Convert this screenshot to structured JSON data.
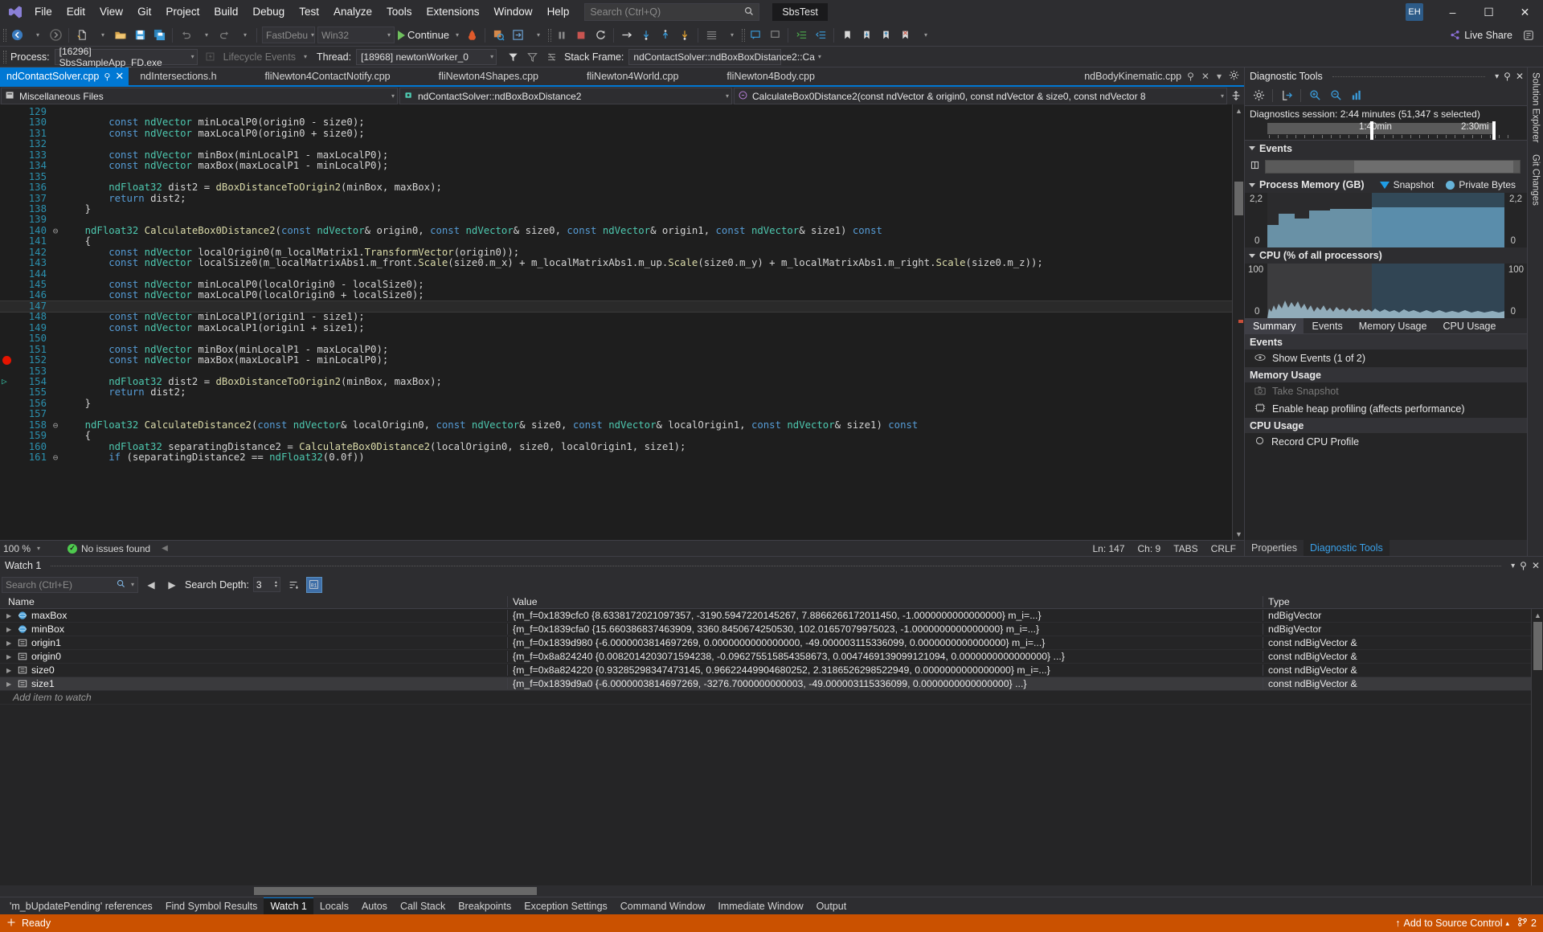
{
  "titlebar": {
    "menu": [
      "File",
      "Edit",
      "View",
      "Git",
      "Project",
      "Build",
      "Debug",
      "Test",
      "Analyze",
      "Tools",
      "Extensions",
      "Window",
      "Help"
    ],
    "search_placeholder": "Search (Ctrl+Q)",
    "solution_name": "SbsTest",
    "account_initials": "EH",
    "minimize": "–",
    "maximize": "☐",
    "close": "✕"
  },
  "toolbar": {
    "config": "FastDebu",
    "platform": "Win32",
    "continue_label": "Continue",
    "live_share": "Live Share"
  },
  "debugbar": {
    "process_label": "Process:",
    "process_value": "[16296] SbsSampleApp_FD.exe",
    "lifecycle_label": "Lifecycle Events",
    "thread_label": "Thread:",
    "thread_value": "[18968] newtonWorker_0",
    "stackframe_label": "Stack Frame:",
    "stackframe_value": "ndContactSolver::ndBoxBoxDistance2::Ca"
  },
  "tabs": [
    {
      "label": "ndContactSolver.cpp",
      "active": true
    },
    {
      "label": "ndIntersections.h",
      "active": false
    },
    {
      "label": "fliNewton4ContactNotify.cpp",
      "active": false
    },
    {
      "label": "fliNewton4Shapes.cpp",
      "active": false
    },
    {
      "label": "fliNewton4World.cpp",
      "active": false
    },
    {
      "label": "fliNewton4Body.cpp",
      "active": false
    },
    {
      "label": "ndBodyKinematic.cpp",
      "active": false
    }
  ],
  "navbar": {
    "project": "Miscellaneous Files",
    "type": "ndContactSolver::ndBoxBoxDistance2",
    "member": "CalculateBox0Distance2(const ndVector & origin0, const ndVector & size0, const ndVector 8"
  },
  "editor": {
    "first_line": 129,
    "highlight_line": 147,
    "breakpoint_line": 152,
    "bookmark_line": 154,
    "lines": [
      {
        "n": 129,
        "fold": "",
        "text": ""
      },
      {
        "n": 130,
        "fold": "",
        "text": "        const ndVector minLocalP0(origin0 - size0);"
      },
      {
        "n": 131,
        "fold": "",
        "text": "        const ndVector maxLocalP0(origin0 + size0);"
      },
      {
        "n": 132,
        "fold": "",
        "text": ""
      },
      {
        "n": 133,
        "fold": "",
        "text": "        const ndVector minBox(minLocalP1 - maxLocalP0);"
      },
      {
        "n": 134,
        "fold": "",
        "text": "        const ndVector maxBox(maxLocalP1 - minLocalP0);"
      },
      {
        "n": 135,
        "fold": "",
        "text": ""
      },
      {
        "n": 136,
        "fold": "",
        "text": "        ndFloat32 dist2 = dBoxDistanceToOrigin2(minBox, maxBox);"
      },
      {
        "n": 137,
        "fold": "",
        "text": "        return dist2;"
      },
      {
        "n": 138,
        "fold": "",
        "text": "    }"
      },
      {
        "n": 139,
        "fold": "",
        "text": ""
      },
      {
        "n": 140,
        "fold": "⊖",
        "text": "    ndFloat32 CalculateBox0Distance2(const ndVector& origin0, const ndVector& size0, const ndVector& origin1, const ndVector& size1) const"
      },
      {
        "n": 141,
        "fold": "",
        "text": "    {"
      },
      {
        "n": 142,
        "fold": "",
        "text": "        const ndVector localOrigin0(m_localMatrix1.TransformVector(origin0));"
      },
      {
        "n": 143,
        "fold": "",
        "text": "        const ndVector localSize0(m_localMatrixAbs1.m_front.Scale(size0.m_x) + m_localMatrixAbs1.m_up.Scale(size0.m_y) + m_localMatrixAbs1.m_right.Scale(size0.m_z));"
      },
      {
        "n": 144,
        "fold": "",
        "text": ""
      },
      {
        "n": 145,
        "fold": "",
        "text": "        const ndVector minLocalP0(localOrigin0 - localSize0);"
      },
      {
        "n": 146,
        "fold": "",
        "text": "        const ndVector maxLocalP0(localOrigin0 + localSize0);"
      },
      {
        "n": 147,
        "fold": "",
        "text": ""
      },
      {
        "n": 148,
        "fold": "",
        "text": "        const ndVector minLocalP1(origin1 - size1);"
      },
      {
        "n": 149,
        "fold": "",
        "text": "        const ndVector maxLocalP1(origin1 + size1);"
      },
      {
        "n": 150,
        "fold": "",
        "text": ""
      },
      {
        "n": 151,
        "fold": "",
        "text": "        const ndVector minBox(minLocalP1 - maxLocalP0);"
      },
      {
        "n": 152,
        "fold": "",
        "text": "        const ndVector maxBox(maxLocalP1 - minLocalP0);"
      },
      {
        "n": 153,
        "fold": "",
        "text": ""
      },
      {
        "n": 154,
        "fold": "",
        "text": "        ndFloat32 dist2 = dBoxDistanceToOrigin2(minBox, maxBox);"
      },
      {
        "n": 155,
        "fold": "",
        "text": "        return dist2;"
      },
      {
        "n": 156,
        "fold": "",
        "text": "    }"
      },
      {
        "n": 157,
        "fold": "",
        "text": ""
      },
      {
        "n": 158,
        "fold": "⊖",
        "text": "    ndFloat32 CalculateDistance2(const ndVector& localOrigin0, const ndVector& size0, const ndVector& localOrigin1, const ndVector& size1) const"
      },
      {
        "n": 159,
        "fold": "",
        "text": "    {"
      },
      {
        "n": 160,
        "fold": "",
        "text": "        ndFloat32 separatingDistance2 = CalculateBox0Distance2(localOrigin0, size0, localOrigin1, size1);"
      },
      {
        "n": 161,
        "fold": "⊖",
        "text": "        if (separatingDistance2 == ndFloat32(0.0f))"
      }
    ]
  },
  "editor_status": {
    "zoom": "100 %",
    "issues": "No issues found",
    "line": "Ln: 147",
    "col": "Ch: 9",
    "tabs": "TABS",
    "eol": "CRLF"
  },
  "diagnostics": {
    "title": "Diagnostic Tools",
    "session_text": "Diagnostics session: 2:44 minutes (51,347 s selected)",
    "ruler_labels": [
      "1:40min",
      "2:30mi"
    ],
    "events_section": "Events",
    "memory_section": "Process Memory (GB)",
    "memory_legend_snapshot": "Snapshot",
    "memory_legend_private": "Private Bytes",
    "memory_axis_top": "2,2",
    "memory_axis_bottom": "0",
    "cpu_section": "CPU (% of all processors)",
    "cpu_axis_top": "100",
    "cpu_axis_bottom": "0",
    "tabs": [
      "Summary",
      "Events",
      "Memory Usage",
      "CPU Usage"
    ],
    "active_tab": "Summary",
    "summary": [
      {
        "header": "Events",
        "items": [
          {
            "label": "Show Events (1 of 2)",
            "icon": "eye-icon",
            "disabled": false
          }
        ]
      },
      {
        "header": "Memory Usage",
        "items": [
          {
            "label": "Take Snapshot",
            "icon": "camera-icon",
            "disabled": true
          },
          {
            "label": "Enable heap profiling (affects performance)",
            "icon": "chip-icon",
            "disabled": false
          }
        ]
      },
      {
        "header": "CPU Usage",
        "items": [
          {
            "label": "Record CPU Profile",
            "icon": "record-icon",
            "disabled": false
          }
        ]
      }
    ],
    "footer_tabs": [
      "Properties",
      "Diagnostic Tools"
    ],
    "footer_active": "Diagnostic Tools"
  },
  "right_vtabs": [
    "Solution Explorer",
    "Git Changes"
  ],
  "watch": {
    "title": "Watch 1",
    "search_placeholder": "Search (Ctrl+E)",
    "depth_label": "Search Depth:",
    "depth_value": "3",
    "columns": [
      "Name",
      "Value",
      "Type"
    ],
    "add_row": "Add item to watch",
    "rows": [
      {
        "name": "maxBox",
        "icon": "sphere-icon",
        "value": "{m_f=0x1839cfc0 {8.6338172021097357, -3190.5947220145267, 7.8866266172011450, -1.0000000000000000} m_i=...}",
        "type": "ndBigVector",
        "selected": false
      },
      {
        "name": "minBox",
        "icon": "sphere-icon",
        "value": "{m_f=0x1839cfa0 {15.660386837463909, 3360.8450674250530, 102.01657079975023, -1.0000000000000000} m_i=...}",
        "type": "ndBigVector",
        "selected": false
      },
      {
        "name": "origin1",
        "icon": "field-icon",
        "value": "{m_f=0x1839d980 {-6.0000003814697269, 0.0000000000000000, -49.000003115336099, 0.0000000000000000} m_i=...}",
        "type": "const ndBigVector &",
        "selected": false
      },
      {
        "name": "origin0",
        "icon": "field-icon",
        "value": "{m_f=0x8a824240 {0.0082014203071594238, -0.096275515854358673, 0.0047469139099121094, 0.0000000000000000} ...}",
        "type": "const ndBigVector &",
        "selected": false
      },
      {
        "name": "size0",
        "icon": "field-icon",
        "value": "{m_f=0x8a824220 {0.93285298347473145, 0.96622449904680252, 2.3186526298522949, 0.0000000000000000} m_i=...}",
        "type": "const ndBigVector &",
        "selected": false
      },
      {
        "name": "size1",
        "icon": "field-icon",
        "value": "{m_f=0x1839d9a0 {-6.0000003814697269, -3276.7000000000003, -49.000003115336099, 0.0000000000000000} ...}",
        "type": "const ndBigVector &",
        "selected": true
      }
    ]
  },
  "bottom_tabs": [
    {
      "label": "'m_bUpdatePending' references",
      "active": false
    },
    {
      "label": "Find Symbol Results",
      "active": false
    },
    {
      "label": "Watch 1",
      "active": true
    },
    {
      "label": "Locals",
      "active": false
    },
    {
      "label": "Autos",
      "active": false
    },
    {
      "label": "Call Stack",
      "active": false
    },
    {
      "label": "Breakpoints",
      "active": false
    },
    {
      "label": "Exception Settings",
      "active": false
    },
    {
      "label": "Command Window",
      "active": false
    },
    {
      "label": "Immediate Window",
      "active": false
    },
    {
      "label": "Output",
      "active": false
    }
  ],
  "statusbar": {
    "state": "Ready",
    "source_control": "Add to Source Control",
    "repo_count": "2"
  },
  "colors": {
    "accent": "#0078d4",
    "status_orange": "#ca5100",
    "chrome": "#2d2d30",
    "editor_bg": "#1e1e1e",
    "linenum": "#2b91af",
    "keyword": "#569cd6",
    "type": "#4ec9b0",
    "breakpoint": "#e51400"
  }
}
